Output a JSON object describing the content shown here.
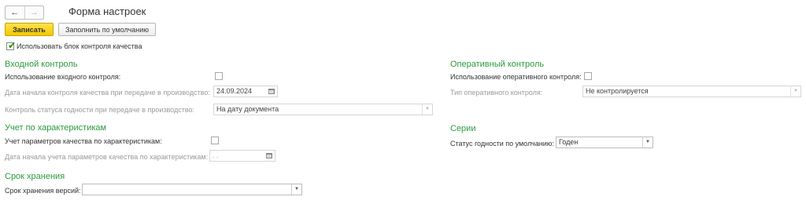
{
  "header": {
    "title": "Форма настроек",
    "nav": {
      "back_icon": "←",
      "forward_icon": "→"
    }
  },
  "toolbar": {
    "save_label": "Записать",
    "fill_default_label": "Заполнить по умолчанию"
  },
  "quality_block": {
    "label": "Использовать блок контроля качества",
    "checked": true
  },
  "incoming_control": {
    "title": "Входной контроль",
    "use_label": "Использование входного контроля:",
    "use_checked": false,
    "start_date_label": "Дата начала контроля качества при передаче в производство:",
    "start_date_value": "24.09.2024",
    "status_label": "Контроль статуса годности при передаче в производство:",
    "status_value": "На дату документа"
  },
  "characteristics": {
    "title": "Учет по характеристикам",
    "params_label": "Учет параметров качества по характеристикам:",
    "params_checked": false,
    "start_date_label": "Дата начала учета параметров качества по характеристикам:",
    "start_date_value": " .  .  "
  },
  "storage": {
    "title": "Срок хранения",
    "versions_label": "Срок хранения версий:",
    "versions_value": ""
  },
  "operative_control": {
    "title": "Оперативный контроль",
    "use_label": "Использование оперативного контроля:",
    "use_checked": false,
    "type_label": "Тип оперативного контроля:",
    "type_value": "Не контролируется"
  },
  "series": {
    "title": "Серии",
    "status_label": "Статус годности по умолчанию:",
    "status_value": "Годен"
  },
  "colors": {
    "section": "#2a9a3c",
    "primary_button": "#f4c800",
    "muted_text": "#9a9a9a"
  }
}
